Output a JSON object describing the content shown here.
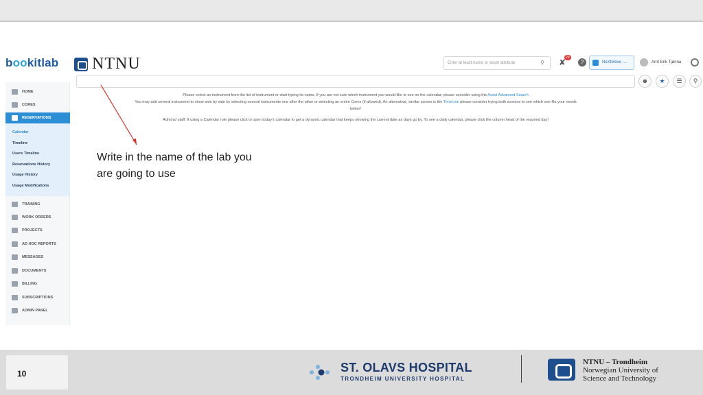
{
  "app": {
    "logo": "bookitlab",
    "org_logo": "NTNU"
  },
  "header": {
    "search_placeholder": "Enter at least name or asset attribute",
    "notif_count": "29",
    "nextmove_label": "NeXtMove -...",
    "user_name": "Arnt Erik Tjønna"
  },
  "sidebar": {
    "items": [
      {
        "label": "HOME",
        "icon": "home-icon"
      },
      {
        "label": "CORES",
        "icon": "database-icon"
      },
      {
        "label": "RESERVATIONS",
        "icon": "calendar-icon"
      },
      {
        "label": "TRAINING",
        "icon": "dumbbell-icon"
      },
      {
        "label": "WORK ORDERS",
        "icon": "folder-icon"
      },
      {
        "label": "PROJECTS",
        "icon": "tag-icon"
      },
      {
        "label": "AD HOC REPORTS",
        "icon": "chart-icon"
      },
      {
        "label": "MESSAGES",
        "icon": "megaphone-icon"
      },
      {
        "label": "DOCUMENTS",
        "icon": "documents-icon"
      },
      {
        "label": "BILLING",
        "icon": "invoice-icon"
      },
      {
        "label": "SUBSCRIPTIONS",
        "icon": "card-icon"
      },
      {
        "label": "ADMIN PANEL",
        "icon": "gear-icon"
      }
    ],
    "sub_items": [
      "Calendar",
      "Timeline",
      "Users Timeline",
      "Reservations History",
      "Usage History",
      "Usage Modifications"
    ]
  },
  "help": {
    "line1a": "Please select an instrument from the list of instrument or start typing its name. If you are not sure which instrument you would like to see on the calendar, please consider using the",
    "line1_link": "Asset Advanced Search",
    "line2a": "You may add several instrument to show side by side by selecting several instruments one after the other or selecting an entire Cores (if allowed). An alternative, similar screen is the",
    "line2_link": "TimeLine",
    "line2b": "please consider trying both screens to see which one fits your needs",
    "line3": "better!",
    "line4": "Admins/ staff: If using a Calendar role please click to open today's calendar to get a dynamic calendar that keeps showing the current date as days go by. To see a daily calendar, please click the column head of the required day!"
  },
  "annotation": {
    "line1": "Write in the name of the lab you",
    "line2": "are going to use",
    "color": "#d9312b"
  },
  "footer": {
    "page_number": "10",
    "hospital_name": "ST. OLAVS HOSPITAL",
    "hospital_sub": "TRONDHEIM UNIVERSITY HOSPITAL",
    "ntnu_line1": "NTNU – Trondheim",
    "ntnu_line2": "Norwegian University of",
    "ntnu_line3": "Science and Technology"
  },
  "colors": {
    "accent": "#2c8fd6",
    "brand_dark": "#1f3b6e"
  }
}
